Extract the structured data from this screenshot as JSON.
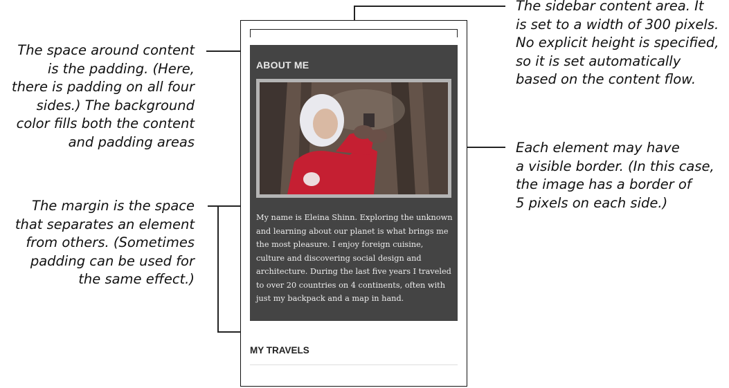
{
  "annotations": {
    "padding": "The space around content\nis the padding. (Here,\nthere is padding on all four\nsides.) The background\ncolor fills both the content\nand padding areas",
    "margin": "The margin is the space\nthat separates an element\nfrom others. (Sometimes\npadding can be used for\nthe same effect.)",
    "content": "The sidebar content area. It\nis set to a width of 300 pixels.\nNo explicit height is specified,\nso it is set automatically\nbased on the content flow.",
    "border": "Each element may have\na visible border. (In this case,\nthe image has a border of\n5 pixels on each side.)"
  },
  "sidebar": {
    "about_heading": "ABOUT ME",
    "about_text": "My name is Eleina Shinn. Exploring the unknown and learning about our planet is what brings me the most pleasure. I enjoy foreign cuisine, culture and discovering social design and architecture. During the last five years I traveled to over 20 countries on 4 continents, often with just my backpack and a map in hand.",
    "travels_heading": "MY TRAVELS"
  },
  "colors": {
    "box_background": "#444444",
    "image_border": "#b4b4b4"
  }
}
